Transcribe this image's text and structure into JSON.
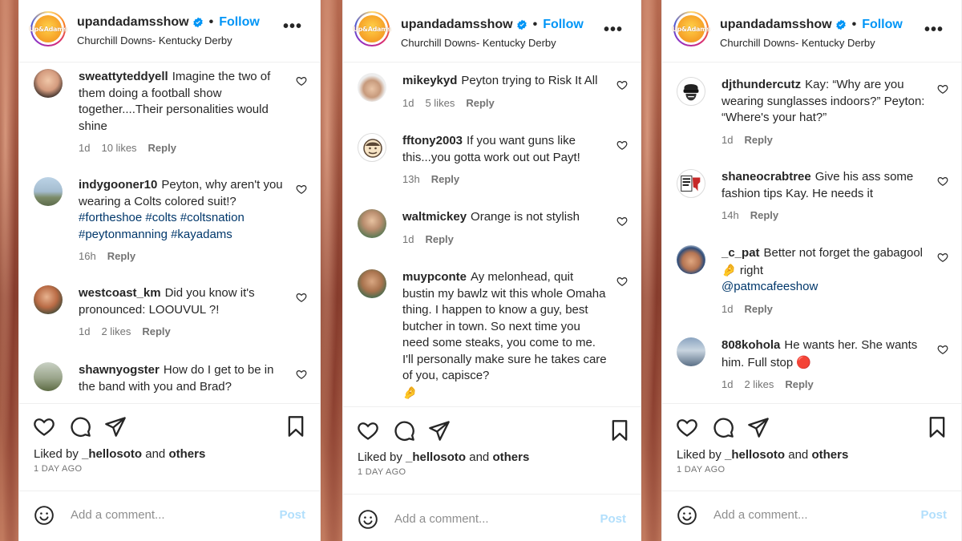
{
  "post": {
    "username": "upandadamsshow",
    "follow_label": "Follow",
    "dot": "•",
    "location": "Churchill Downs- Kentucky Derby",
    "more_label": "•••",
    "logo_text": "Up&Adams",
    "liked_prefix": "Liked by",
    "liked_user": "_hellosoto",
    "liked_and": "and",
    "liked_others": "others",
    "time_ago": "1 DAY AGO",
    "add_comment_placeholder": "Add a comment...",
    "post_label": "Post",
    "colors": {
      "link_blue": "#0095f6",
      "post_disabled": "#b2dffc",
      "hashtag": "#00376b"
    }
  },
  "panels": [
    {
      "comments": [
        {
          "user": "sweattyteddyell",
          "text": "Imagine the two of them doing a football show together....Their personalities would shine",
          "time": "1d",
          "likes": "10 likes",
          "reply": "Reply"
        },
        {
          "user": "indygooner10",
          "text": "Peyton, why aren't you wearing a Colts colored suit!?",
          "hashtags": "#fortheshoe #colts #coltsnation #peytonmanning #kayadams",
          "time": "16h",
          "likes": "",
          "reply": "Reply"
        },
        {
          "user": "westcoast_km",
          "text": "Did you know it's pronounced: LOOUVUL ?!",
          "time": "1d",
          "likes": "2 likes",
          "reply": "Reply"
        },
        {
          "user": "shawnyogster",
          "text": "How do I get to be in the band with you and Brad?",
          "time": "",
          "likes": "",
          "reply": ""
        }
      ]
    },
    {
      "comments": [
        {
          "user": "mikeykyd",
          "text": "Peyton trying to Risk It All",
          "time": "1d",
          "likes": "5 likes",
          "reply": "Reply"
        },
        {
          "user": "fftony2003",
          "text": "If you want guns like this...you gotta work out out Payt!",
          "time": "13h",
          "likes": "",
          "reply": "Reply"
        },
        {
          "user": "waltmickey",
          "text": "Orange is not stylish",
          "time": "1d",
          "likes": "",
          "reply": "Reply"
        },
        {
          "user": "muypconte",
          "text": "Ay melonhead, quit bustin my bawlz wit this whole Omaha thing. I happen to know a guy, best butcher in town. So next time you need some steaks, you come to me. I'll personally make sure he takes care of you, capisce?",
          "emoji": "🤌",
          "time": "",
          "likes": "",
          "reply": ""
        }
      ]
    },
    {
      "comments": [
        {
          "user": "djthundercutz",
          "text": "Kay: “Why are you wearing sunglasses indoors?” Peyton: “Where's your hat?”",
          "time": "1d",
          "likes": "",
          "reply": "Reply"
        },
        {
          "user": "shaneocrabtree",
          "text": "Give his ass some fashion tips Kay. He needs it",
          "time": "14h",
          "likes": "",
          "reply": "Reply"
        },
        {
          "user": "_c_pat",
          "text": "Better not forget the gabagool",
          "emoji": "🤌",
          "text2": "right",
          "mention": "@patmcafeeshow",
          "time": "1d",
          "likes": "",
          "reply": "Reply"
        },
        {
          "user": "808kohola",
          "text": "He wants her. She wants him. Full stop",
          "emoji": "🔴",
          "time": "1d",
          "likes": "2 likes",
          "reply": "Reply"
        }
      ]
    }
  ]
}
